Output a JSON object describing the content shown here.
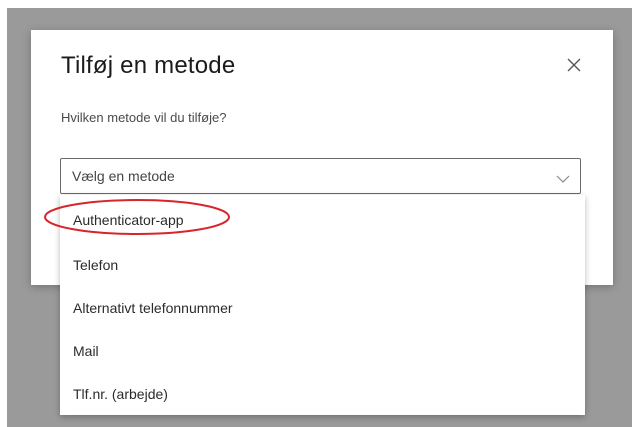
{
  "dialog": {
    "title": "Tilføj en metode",
    "subtitle": "Hvilken metode vil du tilføje?",
    "close_icon": "close-icon"
  },
  "select": {
    "placeholder": "Vælg en metode",
    "chevron_icon": "chevron-down-icon"
  },
  "dropdown": {
    "options": [
      {
        "label": "Authenticator-app",
        "highlighted": true
      },
      {
        "label": "Telefon"
      },
      {
        "label": "Alternativt telefonnummer"
      },
      {
        "label": "Mail"
      },
      {
        "label": "Tlf.nr. (arbejde)"
      }
    ]
  },
  "colors": {
    "overlay": "#9a9a9a",
    "highlight_ring": "#d6262b",
    "border": "#6b6b6b"
  }
}
